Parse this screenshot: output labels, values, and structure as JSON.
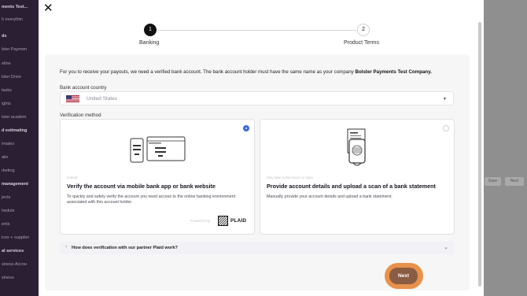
{
  "background": {
    "sidebar_items": [
      "ments Test...",
      "h everythin",
      "ds",
      "lster Paymen",
      "eline",
      "lster Drive",
      "tasks",
      "ights",
      "lster academ",
      "d estimating",
      "imates",
      "ails",
      "rketing",
      "management",
      "jects",
      "hedule",
      "ents",
      "ices + supplier",
      "al services",
      "siness Accou",
      "siness"
    ],
    "right_buttons": [
      "Save",
      "Next"
    ]
  },
  "modal": {
    "close_label": "✕",
    "steps": [
      {
        "number": "1",
        "label": "Banking"
      },
      {
        "number": "2",
        "label": "Product Terms"
      }
    ],
    "intro_text": "For you to receive your payouts, we need a verified bank account. The bank account holder must have the same name as your company ",
    "company_name": "Bolster Payments Test Company",
    "intro_end": ".",
    "country_label": "Bank account country",
    "country_value": "United States",
    "verification_label": "Verification method",
    "methods": [
      {
        "kicker": "Instant",
        "title": "Verify the account via mobile bank app or bank website",
        "description": "To quickly and safely verify the account you need access to the online banking environment associated with this account holder.",
        "powered_by": "Powered by",
        "provider": "PLAID",
        "selected": true
      },
      {
        "kicker": "May take a few hours or days",
        "title": "Provide account details and upload a scan of a bank statement",
        "description": "Manually provide your account details and upload a bank statement.",
        "selected": false
      }
    ],
    "faq_question": "How does verification with our partner Plaid work?",
    "next_label": "Next"
  },
  "colors": {
    "accent_blue": "#3d66e0",
    "next_button": "#8a5c43",
    "next_halo": "#e8914a",
    "step_active": "#111111"
  }
}
